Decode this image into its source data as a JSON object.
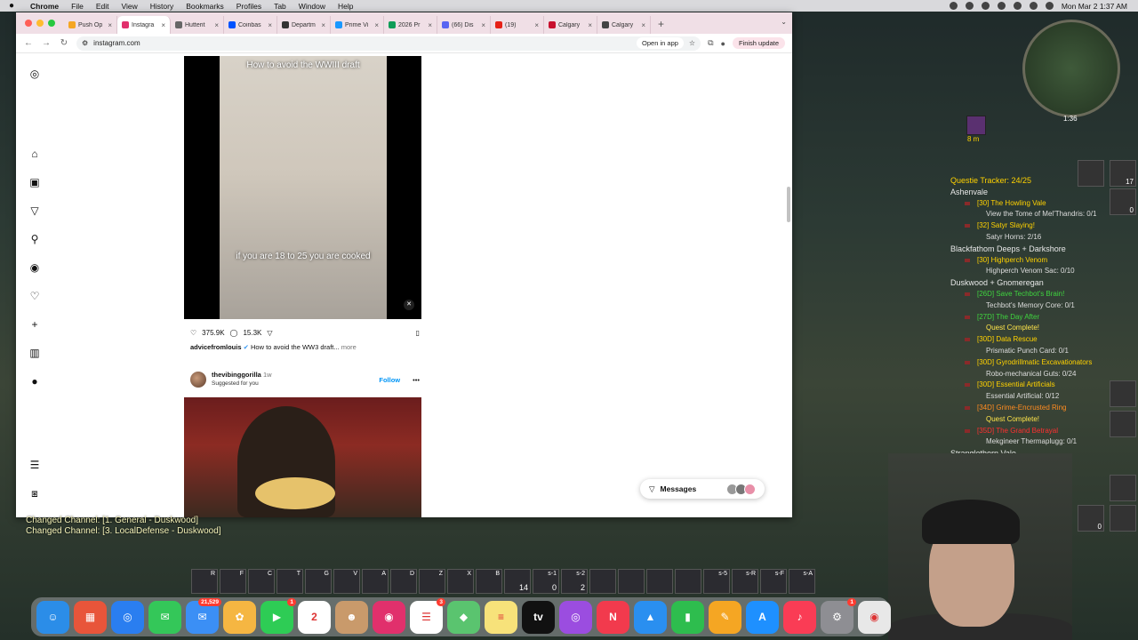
{
  "menubar": {
    "app": "Chrome",
    "items": [
      "File",
      "Edit",
      "View",
      "History",
      "Bookmarks",
      "Profiles",
      "Tab",
      "Window",
      "Help"
    ],
    "clock": "Mon Mar 2  1:37 AM"
  },
  "tabs": [
    {
      "label": "Push Op",
      "color": "#f5a623"
    },
    {
      "label": "Instagra",
      "color": "#e1306c"
    },
    {
      "label": "Hutterit",
      "color": "#666666"
    },
    {
      "label": "Coinbas",
      "color": "#0052ff"
    },
    {
      "label": "Departm",
      "color": "#333333"
    },
    {
      "label": "Prime Vi",
      "color": "#1a98ff"
    },
    {
      "label": "2026 Pr",
      "color": "#0f9d58"
    },
    {
      "label": "(66) Dis",
      "color": "#5865f2"
    },
    {
      "label": "(19)",
      "color": "#e62117"
    },
    {
      "label": "Calgary",
      "color": "#c8102e"
    },
    {
      "label": "Calgary",
      "color": "#444444"
    }
  ],
  "toolbar": {
    "url": "instagram.com",
    "open_in_app": "Open in app",
    "finish_update": "Finish update"
  },
  "reel": {
    "title": "How to avoid the WWIII draft",
    "caption": "if you are 18 to 25 you are cooked",
    "likes": "375.9K",
    "comments": "15.3K",
    "author": "advicefromlouis",
    "caption_text": "How to avoid the WW3 draft...",
    "more": "more"
  },
  "post2": {
    "username": "thevibinggorilla",
    "time": "1w",
    "suggested": "Suggested for you",
    "follow": "Follow"
  },
  "messages": {
    "label": "Messages"
  },
  "game": {
    "minimap_time": "1:36",
    "buff_time": "8 m",
    "tracker_title": "Questie Tracker: 24/25",
    "zones": [
      {
        "name": "Ashenvale",
        "quests": [
          {
            "title": "[30] The Howling Vale",
            "cls": "c-yellow",
            "objectives": [
              "View the Tome of Mel'Thandris: 0/1"
            ]
          },
          {
            "title": "[32] Satyr Slaying!",
            "cls": "c-yellow",
            "objectives": [
              "Satyr Horns: 2/16"
            ]
          }
        ]
      },
      {
        "name": "Blackfathom Deeps + Darkshore",
        "quests": [
          {
            "title": "[30] Highperch Venom",
            "cls": "c-yellow",
            "objectives": [
              "Highperch Venom Sac: 0/10"
            ]
          }
        ]
      },
      {
        "name": "Duskwood + Gnomeregan",
        "quests": [
          {
            "title": "[26D] Save Techbot's Brain!",
            "cls": "c-green",
            "objectives": [
              "Techbot's Memory Core: 0/1"
            ]
          },
          {
            "title": "[27D] The Day After",
            "cls": "c-green",
            "complete": "Quest Complete!"
          },
          {
            "title": "[30D] Data Rescue",
            "cls": "c-yellow",
            "objectives": [
              "Prismatic Punch Card: 0/1"
            ]
          },
          {
            "title": "[30D] Gyrodrillmatic Excavationators",
            "cls": "c-yellow",
            "objectives": [
              "Robo-mechanical Guts: 0/24"
            ]
          },
          {
            "title": "[30D] Essential Artificials",
            "cls": "c-yellow",
            "objectives": [
              "Essential Artificial: 0/12"
            ]
          },
          {
            "title": "[34D] Grime-Encrusted Ring",
            "cls": "c-orange",
            "complete": "Quest Complete!"
          },
          {
            "title": "[35D] The Grand Betrayal",
            "cls": "c-red",
            "objectives": [
              "Mekgineer Thermaplugg: 0/1"
            ]
          }
        ]
      },
      {
        "name": "Stranglethorn Vale",
        "quests": []
      }
    ],
    "chat": [
      "Changed Channel: [1. General - Duskwood]",
      "Changed Channel: [3. LocalDefense - Duskwood]"
    ],
    "actionbar": [
      {
        "key": "R",
        "count": ""
      },
      {
        "key": "F",
        "count": ""
      },
      {
        "key": "C",
        "count": ""
      },
      {
        "key": "T",
        "count": ""
      },
      {
        "key": "G",
        "count": ""
      },
      {
        "key": "V",
        "count": ""
      },
      {
        "key": "A",
        "count": ""
      },
      {
        "key": "D",
        "count": ""
      },
      {
        "key": "Z",
        "count": ""
      },
      {
        "key": "X",
        "count": ""
      },
      {
        "key": "B",
        "count": ""
      },
      {
        "key": "",
        "count": "14"
      },
      {
        "key": "s-1",
        "count": "0"
      },
      {
        "key": "s-2",
        "count": "2"
      },
      {
        "key": "",
        "count": ""
      },
      {
        "key": "",
        "count": ""
      },
      {
        "key": "",
        "count": ""
      },
      {
        "key": "",
        "count": ""
      },
      {
        "key": "s-5",
        "count": ""
      },
      {
        "key": "s-R",
        "count": ""
      },
      {
        "key": "s-F",
        "count": ""
      },
      {
        "key": "s-A",
        "count": ""
      }
    ],
    "side_counts": [
      "17",
      "0",
      "0"
    ]
  },
  "dock": [
    {
      "name": "finder-app",
      "color": "#2b8de8",
      "glyph": "☺",
      "badge": ""
    },
    {
      "name": "launchpad-app",
      "color": "#e8553a",
      "glyph": "▦",
      "badge": ""
    },
    {
      "name": "safari-app",
      "color": "#2a7ef0",
      "glyph": "◎",
      "badge": ""
    },
    {
      "name": "messages-app",
      "color": "#34c759",
      "glyph": "✉",
      "badge": ""
    },
    {
      "name": "mail-app",
      "color": "#3b8ff5",
      "glyph": "✉",
      "badge": "21,529"
    },
    {
      "name": "photos-app",
      "color": "#f5b642",
      "glyph": "✿",
      "badge": ""
    },
    {
      "name": "facetime-app",
      "color": "#2ecc55",
      "glyph": "▶",
      "badge": "1"
    },
    {
      "name": "calendar-app",
      "color": "#ffffff",
      "glyph": "2",
      "badge": ""
    },
    {
      "name": "contacts-app",
      "color": "#c99a6b",
      "glyph": "☻",
      "badge": ""
    },
    {
      "name": "instagram-app",
      "color": "#e1306c",
      "glyph": "◉",
      "badge": ""
    },
    {
      "name": "reminders-app",
      "color": "#ffffff",
      "glyph": "☰",
      "badge": "3"
    },
    {
      "name": "maps-app",
      "color": "#5ac46f",
      "glyph": "◆",
      "badge": ""
    },
    {
      "name": "notes-app",
      "color": "#f7e27a",
      "glyph": "≡",
      "badge": ""
    },
    {
      "name": "appletv-app",
      "color": "#111111",
      "glyph": "tv",
      "badge": ""
    },
    {
      "name": "podcasts-app",
      "color": "#9b4de0",
      "glyph": "◎",
      "badge": ""
    },
    {
      "name": "news-app",
      "color": "#f23a4d",
      "glyph": "N",
      "badge": ""
    },
    {
      "name": "keynote-app",
      "color": "#2a8ff0",
      "glyph": "▲",
      "badge": ""
    },
    {
      "name": "numbers-app",
      "color": "#2ebd4e",
      "glyph": "▮",
      "badge": ""
    },
    {
      "name": "pages-app",
      "color": "#f5a623",
      "glyph": "✎",
      "badge": ""
    },
    {
      "name": "appstore-app",
      "color": "#1e90ff",
      "glyph": "A",
      "badge": ""
    },
    {
      "name": "music-app",
      "color": "#fa3c55",
      "glyph": "♪",
      "badge": ""
    },
    {
      "name": "settings-app",
      "color": "#8e8e93",
      "glyph": "⚙",
      "badge": "1"
    },
    {
      "name": "chrome-app",
      "color": "#e8e8e8",
      "glyph": "◉",
      "badge": ""
    }
  ]
}
